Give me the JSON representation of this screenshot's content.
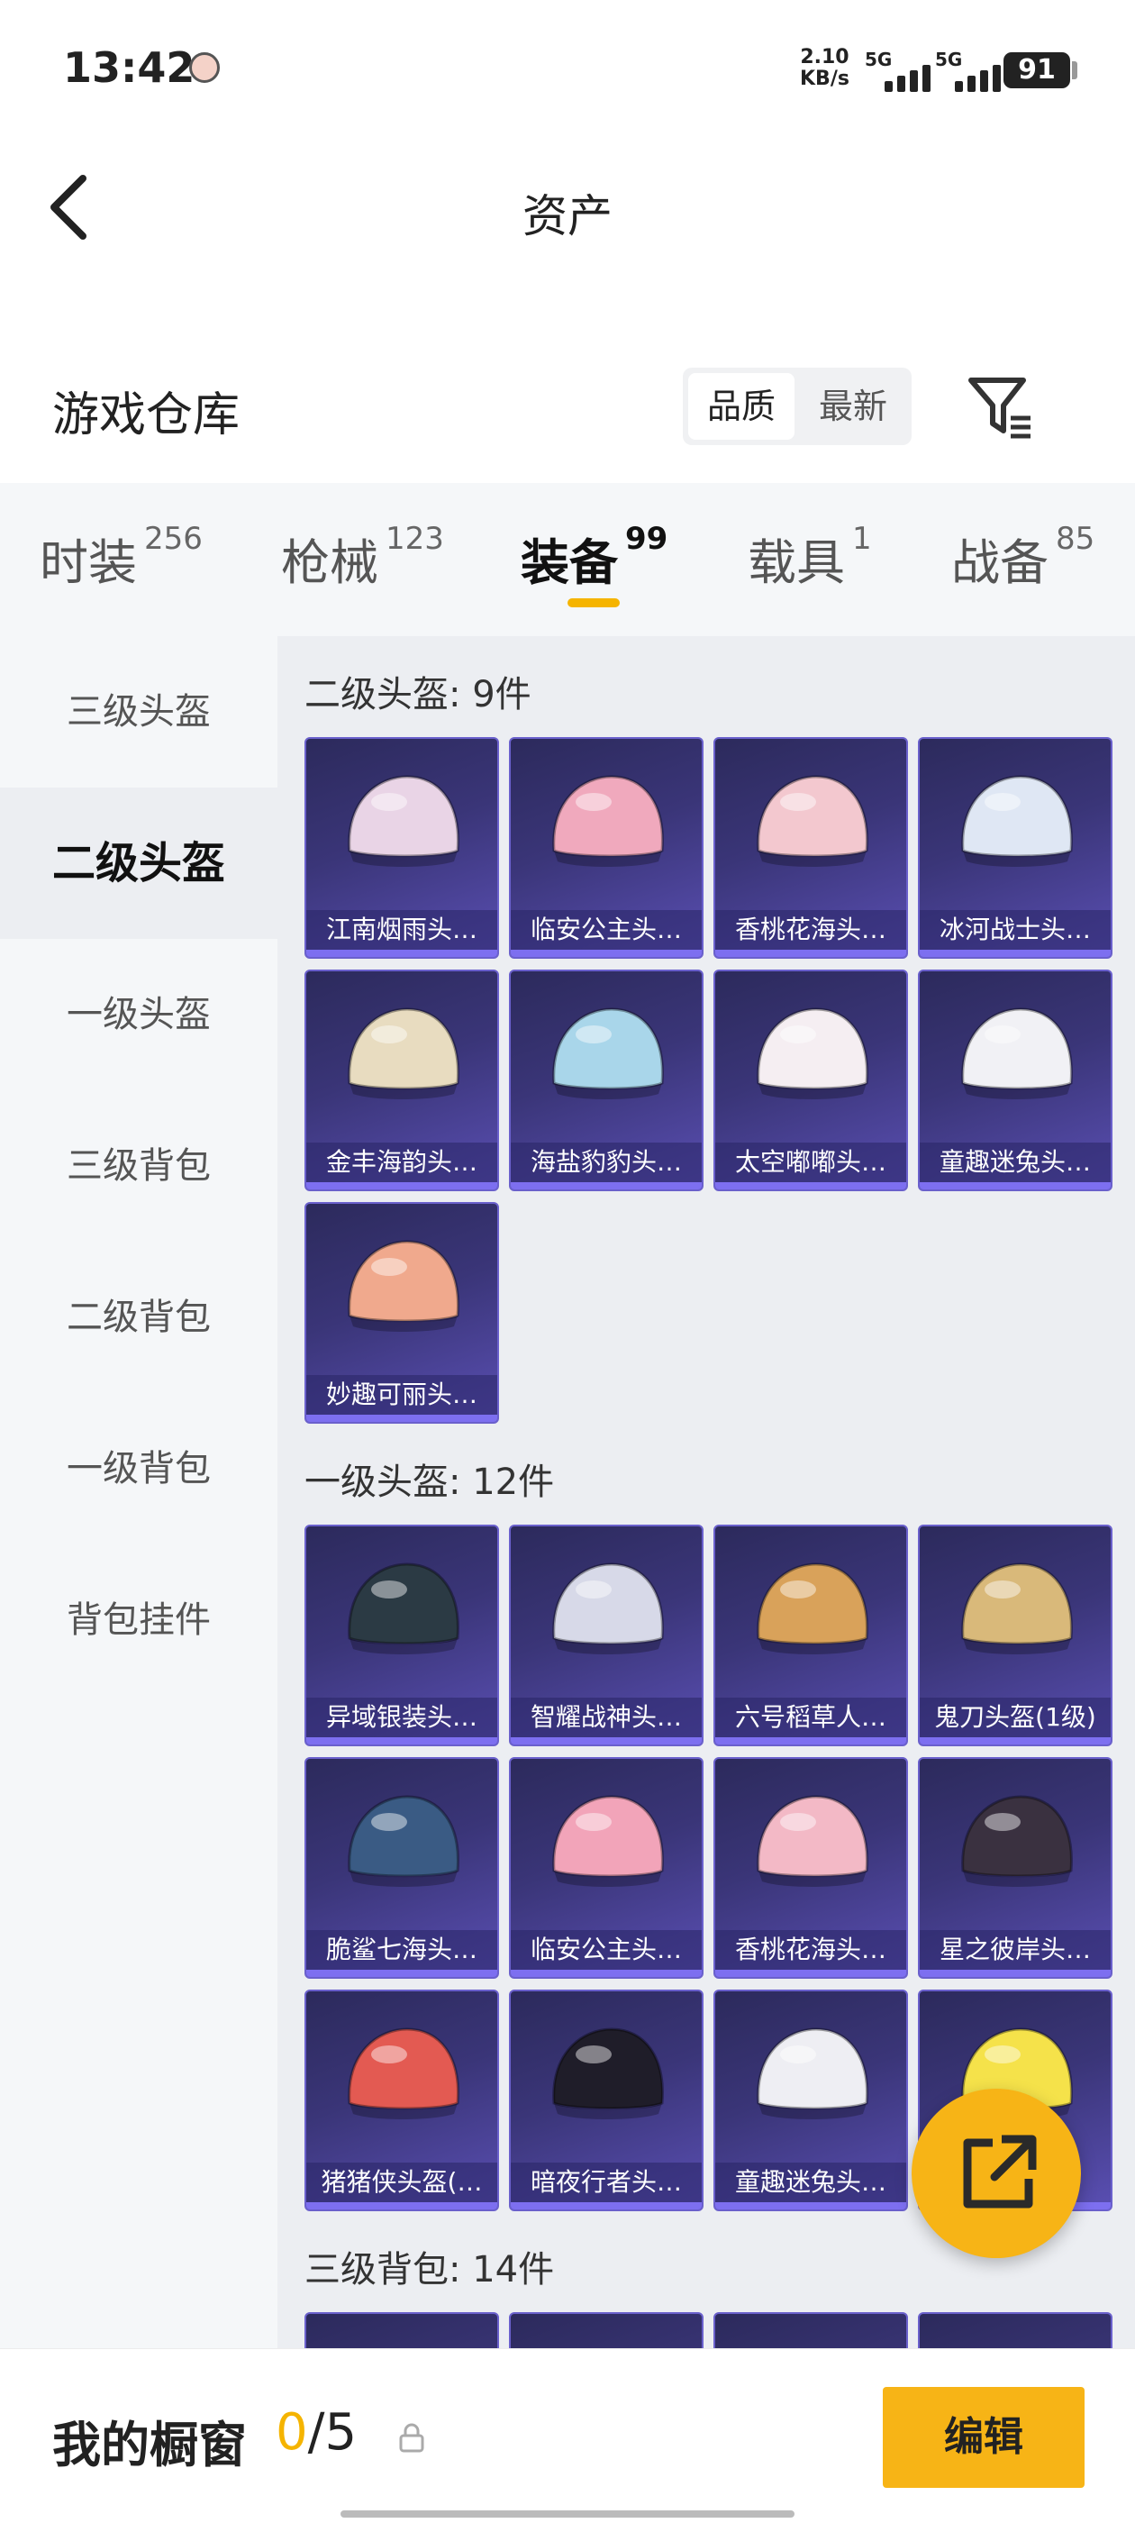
{
  "status_bar": {
    "time": "13:42",
    "net_speed_value": "2.10",
    "net_speed_unit": "KB/s",
    "sim1_label": "5G",
    "sim2_label": "5G",
    "battery": "91"
  },
  "header": {
    "title": "资产",
    "back_icon": "chevron-left-icon"
  },
  "warehouse": {
    "title": "游戏仓库",
    "sort_options": [
      "品质",
      "最新"
    ],
    "selected_sort": "品质",
    "filter_icon": "filter-icon"
  },
  "tabs": [
    {
      "label": "时装",
      "count": "256"
    },
    {
      "label": "枪械",
      "count": "123"
    },
    {
      "label": "装备",
      "count": "99"
    },
    {
      "label": "载具",
      "count": "1"
    },
    {
      "label": "战备",
      "count": "85"
    }
  ],
  "active_tab": "装备",
  "side_nav": {
    "items": [
      "三级头盔",
      "二级头盔",
      "一级头盔",
      "三级背包",
      "二级背包",
      "一级背包",
      "背包挂件"
    ],
    "selected": "二级头盔"
  },
  "sections": [
    {
      "title": "二级头盔: 9件",
      "items": [
        {
          "label": "江南烟雨头…",
          "color": "#e9d4e6"
        },
        {
          "label": "临安公主头…",
          "color": "#f0a9bd"
        },
        {
          "label": "香桃花海头…",
          "color": "#f3c8cf"
        },
        {
          "label": "冰河战士头…",
          "color": "#dfe7f4"
        },
        {
          "label": "金丰海韵头…",
          "color": "#e8dcc0"
        },
        {
          "label": "海盐豹豹头…",
          "color": "#a9d6ea"
        },
        {
          "label": "太空嘟嘟头…",
          "color": "#f5eef2"
        },
        {
          "label": "童趣迷兔头…",
          "color": "#f1f1f5"
        },
        {
          "label": "妙趣可丽头…",
          "color": "#f0a98d"
        }
      ]
    },
    {
      "title": "一级头盔: 12件",
      "items": [
        {
          "label": "异域银装头…",
          "color": "#2b3a44"
        },
        {
          "label": "智耀战神头…",
          "color": "#d7d9e8"
        },
        {
          "label": "六号稻草人…",
          "color": "#d9a25a"
        },
        {
          "label": "鬼刀头盔(1级)",
          "color": "#d9b97a"
        },
        {
          "label": "脆鲨七海头…",
          "color": "#3a5b84"
        },
        {
          "label": "临安公主头…",
          "color": "#f2a4b9"
        },
        {
          "label": "香桃花海头…",
          "color": "#f3b9c6"
        },
        {
          "label": "星之彼岸头…",
          "color": "#3a3140"
        },
        {
          "label": "猪猪侠头盔(…",
          "color": "#e35a52"
        },
        {
          "label": "暗夜行者头…",
          "color": "#1f1d29"
        },
        {
          "label": "童趣迷兔头…",
          "color": "#eeeef3"
        },
        {
          "label": "",
          "color": "#f5e24a"
        }
      ]
    },
    {
      "title": "三级背包: 14件",
      "items": [
        {
          "label": "",
          "color": "#4a4680"
        },
        {
          "label": "",
          "color": "#4a4680"
        },
        {
          "label": "",
          "color": "#4a4680"
        },
        {
          "label": "",
          "color": "#4a4680"
        }
      ]
    }
  ],
  "bottom_bar": {
    "showcase_label": "我的橱窗",
    "showcase_filled": "0",
    "showcase_total": "/5",
    "edit_label": "编辑"
  },
  "colors": {
    "accent": "#f7b416",
    "card_bg": "#3a3578",
    "card_border": "#6a60cc"
  }
}
